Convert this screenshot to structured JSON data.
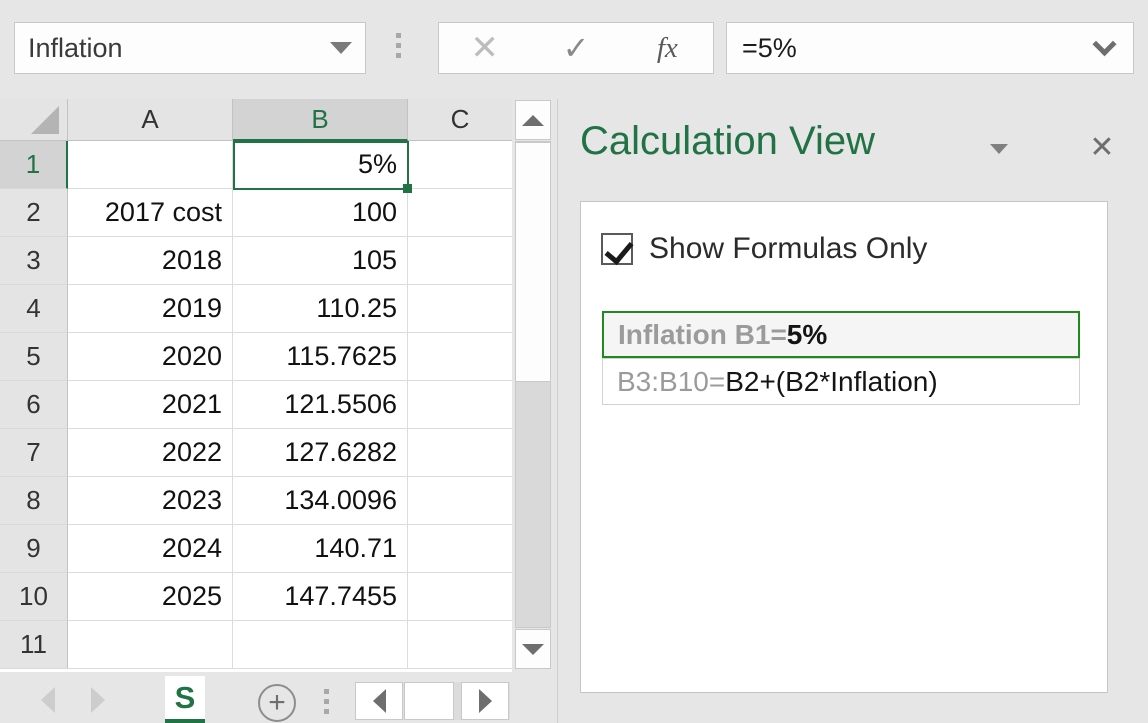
{
  "namebox": {
    "value": "Inflation",
    "caret_icon": "chevron-down-icon"
  },
  "formula_tools": {
    "cancel_icon": "close-x-icon",
    "accept_icon": "check-icon",
    "function_icon": "fx-icon"
  },
  "formula_bar": {
    "value": "=5%",
    "expand_icon": "chevron-down-icon"
  },
  "grid": {
    "select_all_icon": "select-all-corner-icon",
    "columns": [
      "A",
      "B",
      "C"
    ],
    "active_column": "B",
    "active_row": "1",
    "active_cell_ref": "B1",
    "rows": [
      {
        "num": "1",
        "a": "",
        "b": "5%",
        "c": ""
      },
      {
        "num": "2",
        "a": "2017 cost",
        "b": "100",
        "c": ""
      },
      {
        "num": "3",
        "a": "2018",
        "b": "105",
        "c": ""
      },
      {
        "num": "4",
        "a": "2019",
        "b": "110.25",
        "c": ""
      },
      {
        "num": "5",
        "a": "2020",
        "b": "115.7625",
        "c": ""
      },
      {
        "num": "6",
        "a": "2021",
        "b": "121.5506",
        "c": ""
      },
      {
        "num": "7",
        "a": "2022",
        "b": "127.6282",
        "c": ""
      },
      {
        "num": "8",
        "a": "2023",
        "b": "134.0096",
        "c": ""
      },
      {
        "num": "9",
        "a": "2024",
        "b": "140.71",
        "c": ""
      },
      {
        "num": "10",
        "a": "2025",
        "b": "147.7455",
        "c": ""
      },
      {
        "num": "11",
        "a": "",
        "b": "",
        "c": ""
      }
    ]
  },
  "scrollbars": {
    "v_up_icon": "triangle-up-icon",
    "v_down_icon": "triangle-down-icon",
    "h_left_icon": "triangle-left-icon",
    "h_right_icon": "triangle-right-icon"
  },
  "statusbar": {
    "prev_sheet_icon": "triangle-left-icon",
    "next_sheet_icon": "triangle-right-icon",
    "sheet_tab_label": "S",
    "add_sheet_label": "+",
    "grip_icon": "vertical-dots-grip-icon"
  },
  "pane": {
    "title": "Calculation View",
    "menu_icon": "chevron-down-icon",
    "close_label": "✕",
    "checkbox": {
      "label": "Show Formulas Only",
      "checked": true
    },
    "formula_items": [
      {
        "ref": "Inflation B1=",
        "value": "5%",
        "selected": true
      },
      {
        "ref": "B3:B10=",
        "value": "B2+(B2*Inflation)",
        "selected": false
      }
    ]
  },
  "colors": {
    "excel_green": "#217346",
    "selection_green": "#1f8a1f",
    "chrome_gray": "#e6e6e6"
  }
}
